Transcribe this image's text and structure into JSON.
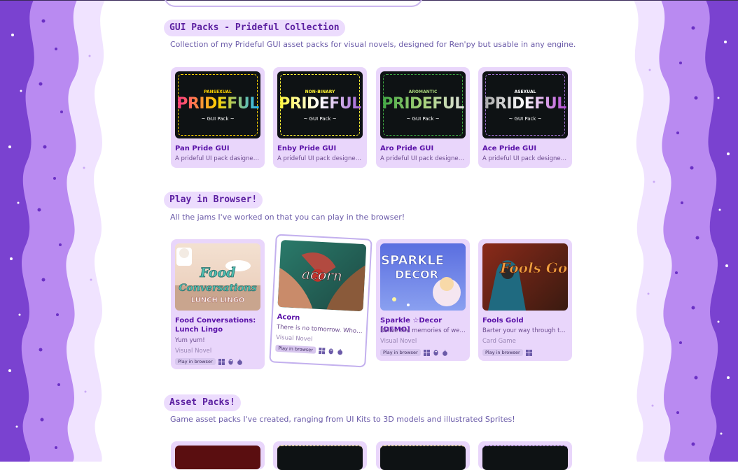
{
  "sections": [
    {
      "title": "GUI Packs - Prideful Collection",
      "description": "Collection of my Prideful GUI asset packs for visual novels, designed for Ren'py but usable in any engine.",
      "cards": [
        {
          "title": "Pan Pride GUI",
          "description": "A prideful UI pack dasigned for Ren'Py",
          "thumb_label": "PANSEXUAL",
          "thumb_word": "PRIDEFUL",
          "thumb_sub": "~ GUI Pack ~",
          "colors": [
            "#ff2d8b",
            "#ffd400",
            "#1bb3ff"
          ]
        },
        {
          "title": "Enby Pride GUI",
          "description": "A prideful UI pack designed for Ren'Py",
          "thumb_label": "NON-BINARY",
          "thumb_word": "PRIDEFUL",
          "thumb_sub": "~ GUI Pack ~",
          "colors": [
            "#fff433",
            "#ffffff",
            "#9c59d1"
          ]
        },
        {
          "title": "Aro Pride GUI",
          "description": "A prideful UI pack designed for Ren'Py",
          "thumb_label": "AROMANTIC",
          "thumb_word": "PRIDEFUL",
          "thumb_sub": "~ GUI Pack ~",
          "colors": [
            "#3da542",
            "#a7d379",
            "#c0c0c0"
          ]
        },
        {
          "title": "Ace Pride GUI",
          "description": "A prideful UI pack designed for Ren'Py",
          "thumb_label": "ASEXUAL",
          "thumb_word": "PRIDEFUL",
          "thumb_sub": "~ GUI Pack ~",
          "colors": [
            "#a3a3a3",
            "#ffffff",
            "#800080"
          ]
        }
      ]
    },
    {
      "title": "Play in Browser!",
      "description": "All the jams I've worked on that you can play in the browser!",
      "cards": [
        {
          "title": "Food Conversations: Lunch Lingo",
          "description": "Yum yum!",
          "genre": "Visual Novel",
          "badge": "Play in browser",
          "thumb_text": "Food Conversations",
          "thumb_sub": "LUNCH LINGO"
        },
        {
          "title": "Acorn",
          "description": "There is no tomorrow. Who will you spend it with?",
          "genre": "Visual Novel",
          "badge": "Play in browser",
          "thumb_text": "acorn"
        },
        {
          "title": "Sparkle ☆Decor [DEMO]",
          "description": "Relive the memories of web decorating",
          "genre": "Visual Novel",
          "badge": "Play in browser",
          "thumb_text": "SPARKLE",
          "thumb_sub": "DECOR"
        },
        {
          "title": "Fools Gold",
          "description": "Barter your way through the market",
          "genre": "Card Game",
          "badge": "Play in browser",
          "thumb_text": "Fools Gold"
        }
      ]
    },
    {
      "title": "Asset Packs!",
      "description": "Game asset packs I've created, ranging from UI Kits to 3D models and illustrated Sprites!"
    }
  ],
  "platform_icons": [
    "windows-icon",
    "linux-icon",
    "apple-icon"
  ],
  "colors": {
    "accent": "#5b1fa0",
    "border_dark": "#6a35c6",
    "border_mid": "#9e6ee8",
    "border_light": "#ddc8f7",
    "card_bg": "#e9d6fb"
  }
}
